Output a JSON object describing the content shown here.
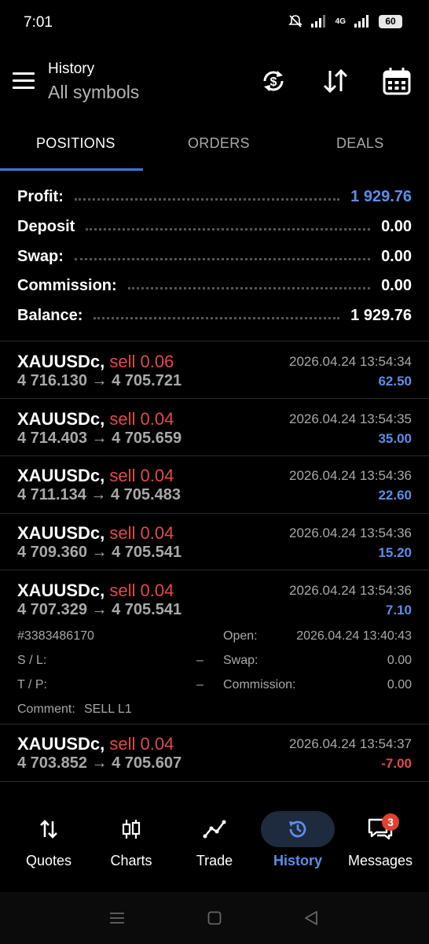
{
  "status_bar": {
    "time": "7:01",
    "network": "4G",
    "battery": "60"
  },
  "header": {
    "title": "History",
    "subtitle": "All symbols",
    "icons": [
      "sync-icon",
      "sort-icon",
      "calendar-icon"
    ]
  },
  "tabs": [
    {
      "label": "POSITIONS",
      "active": true
    },
    {
      "label": "ORDERS",
      "active": false
    },
    {
      "label": "DEALS",
      "active": false
    }
  ],
  "summary": [
    {
      "label": "Profit:",
      "value": "1 929.76",
      "highlight": true
    },
    {
      "label": "Deposit",
      "value": "0.00"
    },
    {
      "label": "Swap:",
      "value": "0.00"
    },
    {
      "label": "Commission:",
      "value": "0.00"
    },
    {
      "label": "Balance:",
      "value": "1 929.76"
    }
  ],
  "positions": [
    {
      "symbol": "XAUUSDc,",
      "side": "sell 0.06",
      "time": "2026.04.24 13:54:34",
      "prices": "4 716.130 → 4 705.721",
      "profit": "62.50",
      "positive": true
    },
    {
      "symbol": "XAUUSDc,",
      "side": "sell 0.04",
      "time": "2026.04.24 13:54:35",
      "prices": "4 714.403 → 4 705.659",
      "profit": "35.00",
      "positive": true
    },
    {
      "symbol": "XAUUSDc,",
      "side": "sell 0.04",
      "time": "2026.04.24 13:54:36",
      "prices": "4 711.134 → 4 705.483",
      "profit": "22.60",
      "positive": true
    },
    {
      "symbol": "XAUUSDc,",
      "side": "sell 0.04",
      "time": "2026.04.24 13:54:36",
      "prices": "4 709.360 → 4 705.541",
      "profit": "15.20",
      "positive": true
    },
    {
      "symbol": "XAUUSDc,",
      "side": "sell 0.04",
      "time": "2026.04.24 13:54:36",
      "prices": "4 707.329 → 4 705.541",
      "profit": "7.10",
      "positive": true
    },
    {
      "symbol": "XAUUSDc,",
      "side": "sell 0.04",
      "time": "2026.04.24 13:54:37",
      "prices": "4 703.852 → 4 705.607",
      "profit": "-7.00",
      "positive": false
    }
  ],
  "expanded_detail": {
    "ticket": "#3383486170",
    "open_label": "Open:",
    "open_value": "2026.04.24 13:40:43",
    "sl_label": "S / L:",
    "sl_value": "–",
    "swap_label": "Swap:",
    "swap_value": "0.00",
    "tp_label": "T / P:",
    "tp_value": "–",
    "commission_label": "Commission:",
    "commission_value": "0.00",
    "comment_label": "Comment:",
    "comment_value": "SELL L1"
  },
  "bottom_nav": [
    {
      "label": "Quotes",
      "icon": "quotes-icon"
    },
    {
      "label": "Charts",
      "icon": "candlestick-chart-icon"
    },
    {
      "label": "Trade",
      "icon": "trade-line-icon"
    },
    {
      "label": "History",
      "icon": "history-icon",
      "active": true
    },
    {
      "label": "Messages",
      "icon": "messages-icon",
      "badge": "3"
    }
  ],
  "colors": {
    "background": "#000000",
    "accent_blue": "#5c8ee8",
    "sell_red": "#e24a4a",
    "muted_text": "#a8a8a8",
    "tab_underline": "#3c78d8"
  }
}
